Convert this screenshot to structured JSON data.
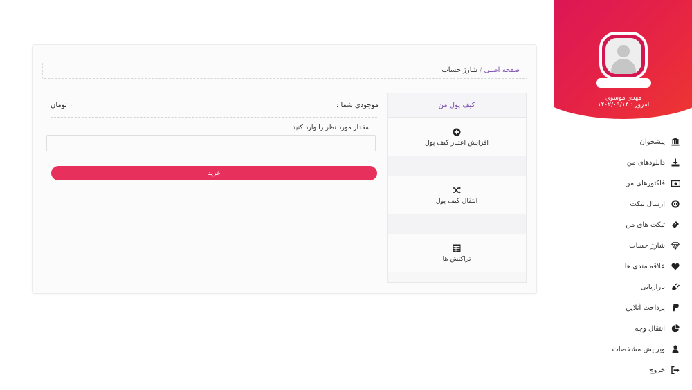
{
  "sidebar": {
    "user_name": "مهدی موسوی",
    "today": "امروز : ۱۴۰۲/۰۹/۱۴",
    "items": [
      {
        "label": "پیشخوان",
        "icon": "bank-icon"
      },
      {
        "label": "دانلودهای من",
        "icon": "download-icon"
      },
      {
        "label": "فاکتورهای من",
        "icon": "money-bill-icon"
      },
      {
        "label": "ارسال تیکت",
        "icon": "life-ring-icon"
      },
      {
        "label": "تیکت های من",
        "icon": "ticket-icon"
      },
      {
        "label": "شارژ حساب",
        "icon": "diamond-icon"
      },
      {
        "label": "علاقه مندی ها",
        "icon": "heart-icon"
      },
      {
        "label": "بازاریابی",
        "icon": "plug-icon"
      },
      {
        "label": "پرداخت آنلاین",
        "icon": "paypal-icon"
      },
      {
        "label": "انتقال وجه",
        "icon": "pie-chart-icon"
      },
      {
        "label": "ویرایش مشخصات",
        "icon": "user-icon"
      },
      {
        "label": "خروج",
        "icon": "sign-out-icon"
      }
    ],
    "accent_gradient": [
      "#d8125c",
      "#f0392e"
    ]
  },
  "breadcrumb": {
    "home": "صفحه اصلی",
    "separator": "/",
    "current": "شارژ حساب"
  },
  "wallet": {
    "title": "کیف پول من",
    "items": [
      {
        "label": "افزایش اعتبار کیف پول",
        "icon": "plus-circle-icon"
      },
      {
        "label": "انتقال کیف پول",
        "icon": "shuffle-icon"
      },
      {
        "label": "تراکنش ها",
        "icon": "table-icon"
      }
    ]
  },
  "form": {
    "balance_label": "موجودی شما :",
    "balance_value": "۰ تومان",
    "amount_label": "مقدار مورد نظر را وارد کنید",
    "amount_value": "",
    "buy_label": "خرید"
  },
  "colors": {
    "accent": "#e8305c",
    "link": "#7a4db0"
  }
}
